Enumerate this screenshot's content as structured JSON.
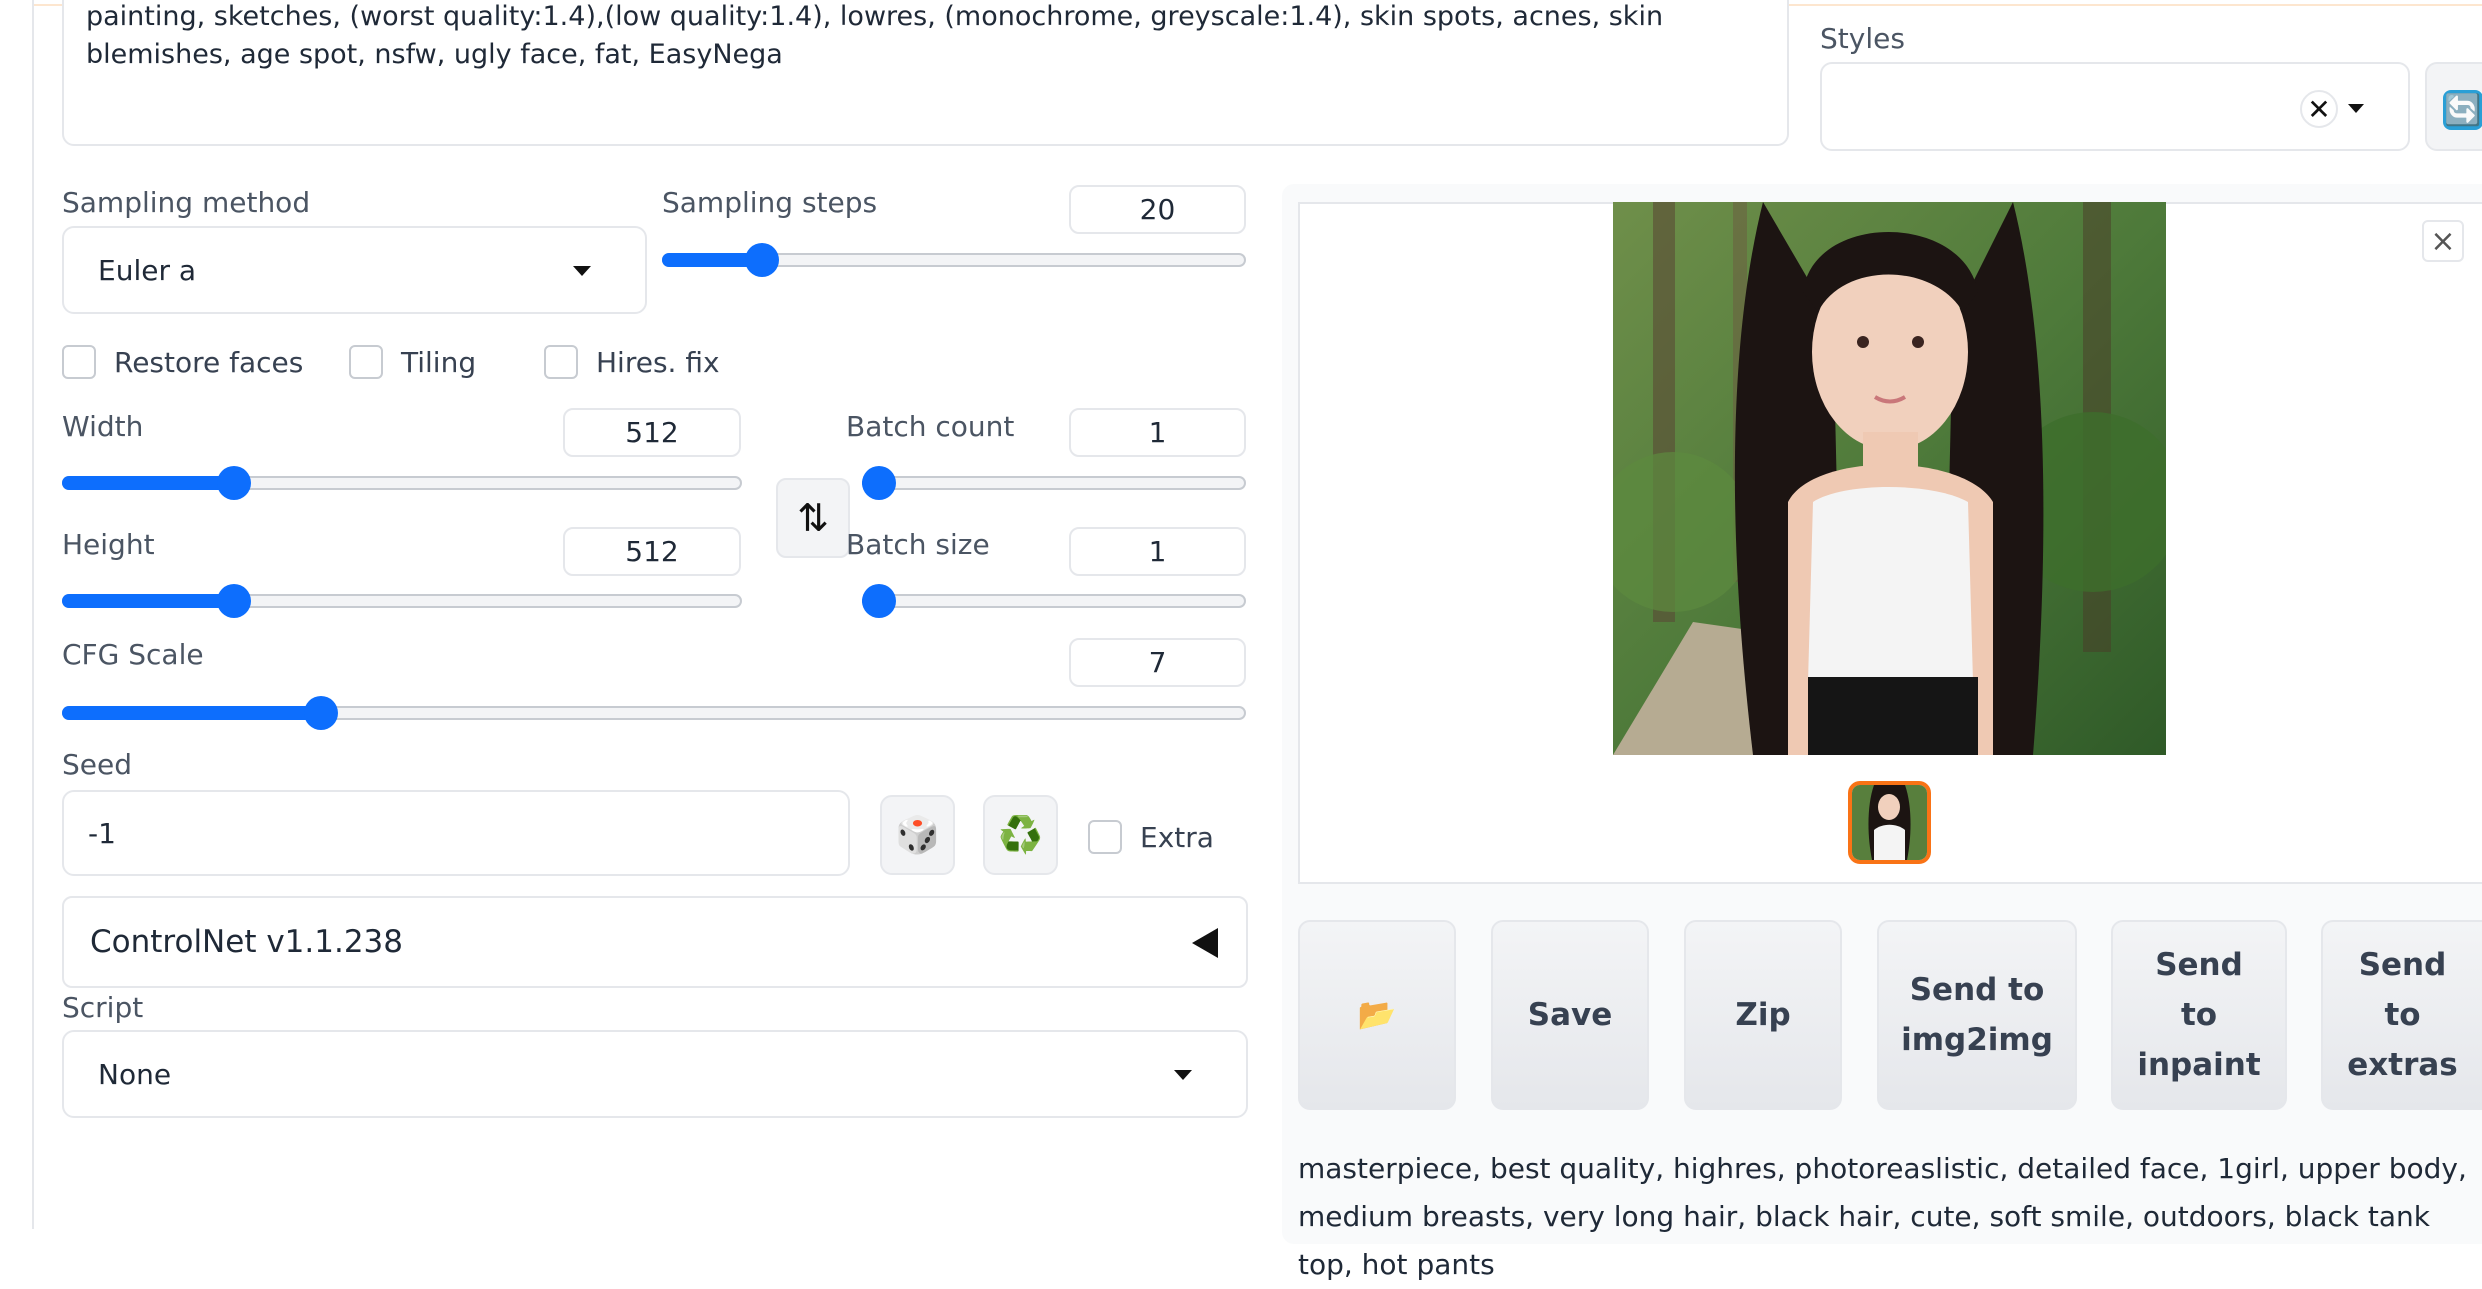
{
  "negative_prompt": "painting, sketches, (worst quality:1.4),(low quality:1.4), lowres, (monochrome, greyscale:1.4), skin spots, acnes, skin blemishes, age spot, nsfw, ugly face, fat, EasyNega",
  "styles": {
    "label": "Styles",
    "value": ""
  },
  "sampling_method": {
    "label": "Sampling method",
    "value": "Euler a"
  },
  "sampling_steps": {
    "label": "Sampling steps",
    "value": "20",
    "fraction": 0.15
  },
  "checkboxes": {
    "restore_faces": "Restore faces",
    "tiling": "Tiling",
    "hires_fix": "Hires. fix"
  },
  "width": {
    "label": "Width",
    "value": "512",
    "fraction": 0.24
  },
  "height": {
    "label": "Height",
    "value": "512",
    "fraction": 0.24
  },
  "batch_count": {
    "label": "Batch count",
    "value": "1",
    "fraction": 0.0
  },
  "batch_size": {
    "label": "Batch size",
    "value": "1",
    "fraction": 0.0
  },
  "cfg_scale": {
    "label": "CFG Scale",
    "value": "7",
    "fraction": 0.21
  },
  "seed": {
    "label": "Seed",
    "value": "-1",
    "extra_label": "Extra"
  },
  "controlnet": {
    "label": "ControlNet v1.1.238"
  },
  "script": {
    "label": "Script",
    "value": "None"
  },
  "actions": {
    "folder_icon": "📂",
    "save": "Save",
    "zip": "Zip",
    "send_img2img_1": "Send to",
    "send_img2img_2": "img2img",
    "send_inpaint_1": "Send",
    "send_inpaint_2": "to",
    "send_inpaint_3": "inpaint",
    "send_extras_1": "Send",
    "send_extras_2": "to",
    "send_extras_3": "extras"
  },
  "icons": {
    "dice": "🎲",
    "recycle": "♻️",
    "swap": "⇅",
    "refresh": "🔄",
    "close": "×",
    "clear": "✕"
  },
  "generation_info": "masterpiece, best quality, highres, photoreaslistic, detailed face, 1girl, upper body, medium breasts, very long hair, black hair, cute, soft smile, outdoors, black tank top, hot pants",
  "colors": {
    "accent": "#0d6efd",
    "selected_thumb": "#f97316"
  }
}
